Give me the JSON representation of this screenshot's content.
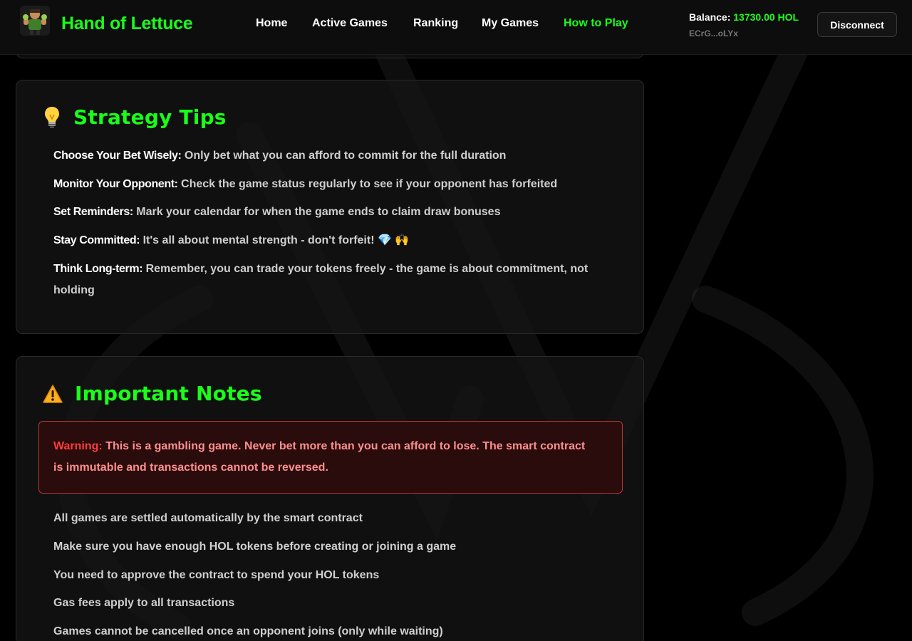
{
  "navbar": {
    "brand": "Hand of Lettuce",
    "links": [
      "Home",
      "Active Games",
      "Ranking",
      "My Games",
      "How to Play"
    ],
    "active_link": "How to Play",
    "balance_label": "Balance:",
    "balance_amount": "13730.00 HOL",
    "address": "ECrG...oLYx",
    "disconnect_label": "Disconnect"
  },
  "strategy": {
    "icon": "lightbulb-icon",
    "title": "Strategy Tips",
    "tips": [
      {
        "label": "Choose Your Bet Wisely:",
        "text": "Only bet what you can afford to commit for the full duration"
      },
      {
        "label": "Monitor Your Opponent:",
        "text": "Check the game status regularly to see if your opponent has forfeited"
      },
      {
        "label": "Set Reminders:",
        "text": "Mark your calendar for when the game ends to claim draw bonuses"
      },
      {
        "label": "Stay Committed:",
        "text": "It's all about mental strength - don't forfeit! 💎 🙌"
      },
      {
        "label": "Think Long-term:",
        "text": "Remember, you can trade your tokens freely - the game is about commitment, not holding"
      }
    ]
  },
  "notes": {
    "icon": "warning-icon",
    "title": "Important Notes",
    "warning_label": "Warning:",
    "warning_text": "This is a gambling game. Never bet more than you can afford to lose. The smart contract is immutable and transactions cannot be reversed.",
    "items": [
      "All games are settled automatically by the smart contract",
      "Make sure you have enough HOL tokens before creating or joining a game",
      "You need to approve the contract to spend your HOL tokens",
      "Gas fees apply to all transactions",
      "Games cannot be cancelled once an opponent joins (only while waiting)"
    ]
  },
  "colors": {
    "accent": "#1aff1a",
    "background": "#000000",
    "warning_border": "#b83535",
    "warning_text": "#ff8e8e"
  }
}
